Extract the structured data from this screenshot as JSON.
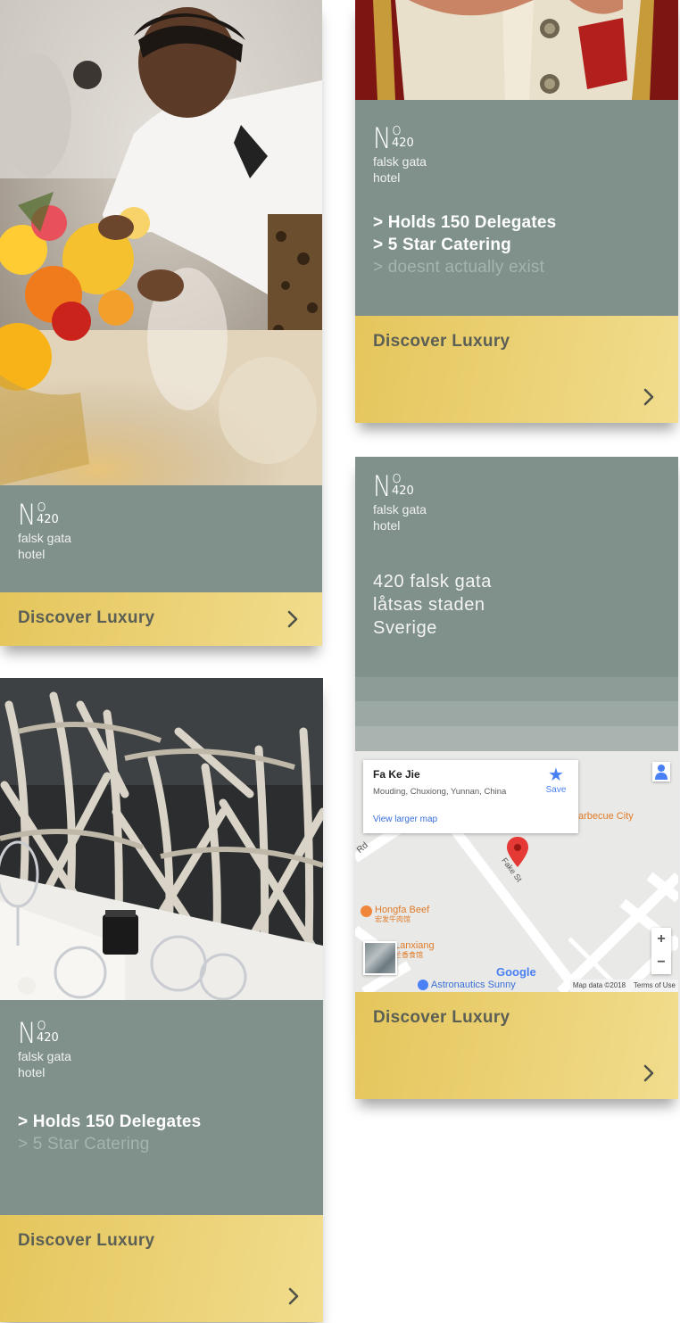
{
  "brand": {
    "number_prefix": "N",
    "number_sup": "o",
    "number": "420",
    "tag_line1": "falsk gata",
    "tag_line2": "hotel"
  },
  "cards": [
    {
      "id": "card-1",
      "photo": "waiter-setting-table-photo",
      "cta_label": "Discover Luxury"
    },
    {
      "id": "card-2",
      "photo": "hands-heart-shape-photo",
      "features": [
        {
          "text": "> Holds 150 Delegates",
          "state": "bright"
        },
        {
          "text": "> 5 Star Catering",
          "state": "bright"
        },
        {
          "text": "> doesnt actually exist",
          "state": "dim"
        }
      ],
      "cta_label": "Discover Luxury"
    },
    {
      "id": "card-3",
      "photo": "wooden-chairs-dining-photo",
      "features": [
        {
          "text": "> Holds 150 Delegates",
          "state": "bright"
        },
        {
          "text": "> 5 Star Catering",
          "state": "dim"
        }
      ],
      "cta_label": "Discover Luxury"
    },
    {
      "id": "card-4",
      "address": [
        "420 falsk gata",
        "låtsas staden",
        "Sverige"
      ],
      "map": {
        "place_title": "Fa Ke Jie",
        "place_address": "Mouding, Chuxiong, Yunnan, China",
        "save_label": "Save",
        "larger_map_link": "View larger map",
        "labels": {
          "barbecue": "arbecue City",
          "rd": "Rd",
          "fake_st": "Fake St",
          "hongfa": "Hongfa Beef",
          "hongfa_cn": "宏发牛肉馆",
          "lanxiang": "Lanxiang",
          "lanxiang_cn": "兰香食馆",
          "astronautics": "Astronautics Sunny",
          "google": "Google",
          "map_data": "Map data ©2018",
          "terms": "Terms of Use",
          "zoom_in": "+",
          "zoom_out": "−"
        }
      },
      "cta_label": "Discover Luxury"
    }
  ],
  "colors": {
    "panel": "#7f918a",
    "cta_gradient_start": "#e5c65c",
    "cta_gradient_end": "#f1dd8e",
    "cta_text": "#5b5f55",
    "map_pin": "#e53935",
    "save_star": "#4a80f5"
  }
}
